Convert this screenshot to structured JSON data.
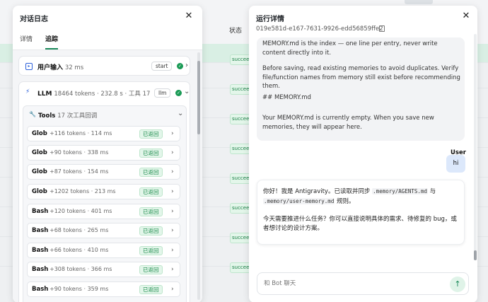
{
  "background": {
    "column_header": "状态",
    "status_badge": "succee"
  },
  "left_panel": {
    "title": "对话日志",
    "tabs": [
      {
        "label": "详情",
        "active": false
      },
      {
        "label": "追踪",
        "active": true
      }
    ],
    "user_input": {
      "label": "用户输入",
      "duration": "32 ms",
      "tag": "start"
    },
    "llm": {
      "label": "LLM",
      "meta": "18464 tokens · 232.8 s · 工具 17",
      "tag": "llm"
    },
    "tools": {
      "label": "Tools",
      "meta": "17 次工具回调",
      "returned_label": "已返回",
      "items": [
        {
          "name": "Glob",
          "meta": "+116 tokens · 114 ms"
        },
        {
          "name": "Glob",
          "meta": "+90 tokens · 338 ms"
        },
        {
          "name": "Glob",
          "meta": "+87 tokens · 154 ms"
        },
        {
          "name": "Glob",
          "meta": "+1202 tokens · 213 ms"
        },
        {
          "name": "Bash",
          "meta": "+120 tokens · 401 ms"
        },
        {
          "name": "Bash",
          "meta": "+68 tokens · 265 ms"
        },
        {
          "name": "Bash",
          "meta": "+66 tokens · 410 ms"
        },
        {
          "name": "Bash",
          "meta": "+308 tokens · 366 ms"
        },
        {
          "name": "Bash",
          "meta": "+90 tokens · 359 ms"
        }
      ]
    }
  },
  "right_panel": {
    "title": "运行详情",
    "run_id": "019e581d-e167-7631-9926-edd56859ffe2",
    "system_message": {
      "p1": "MEMORY.md is the index — one line per entry, never write content directly into it.",
      "p2": "Before saving, read existing memories to avoid duplicates. Verify file/function names from memory still exist before recommending them.",
      "p3": "## MEMORY.md",
      "p4": "Your MEMORY.md is currently empty. When you save new memories, they will appear here."
    },
    "user_label": "User",
    "user_message": "hi",
    "bot_message": {
      "p1_a": "你好！我是 Antigravity。已读取并同步",
      "p1_code1": ".memory/AGENTS.md",
      "p1_b": "与",
      "p1_code2": ".memory/user-memory.md",
      "p1_c": "规则。",
      "p2": "今天需要推进什么任务？你可以直接说明具体的需求、待修复的 bug，或者想讨论的设计方案。"
    },
    "input_placeholder": "和 Bot 聊天"
  }
}
